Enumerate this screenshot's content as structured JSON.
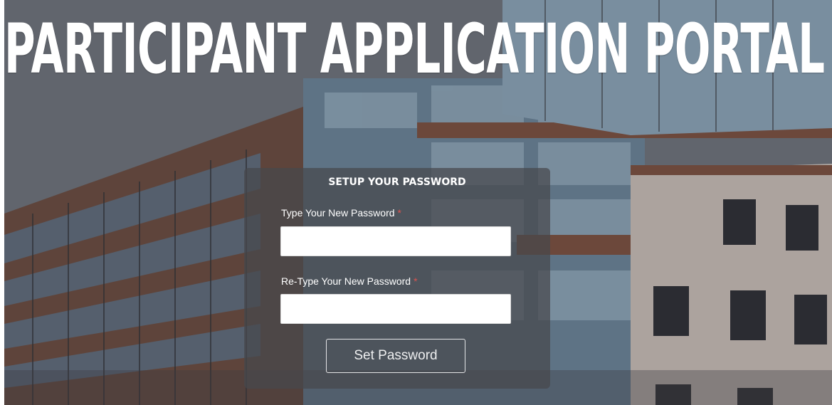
{
  "header": {
    "title": "PARTICIPANT APPLICATION PORTAL"
  },
  "form": {
    "heading": "SETUP YOUR PASSWORD",
    "new_password": {
      "label": "Type Your New Password",
      "required_mark": "*",
      "value": "",
      "placeholder": ""
    },
    "confirm_password": {
      "label": "Re-Type Your New Password",
      "required_mark": "*",
      "value": "",
      "placeholder": ""
    },
    "submit_label": "Set Password"
  },
  "colors": {
    "required": "#d9534f",
    "card_background": "rgba(70,72,76,0.72)",
    "text": "#ffffff"
  }
}
